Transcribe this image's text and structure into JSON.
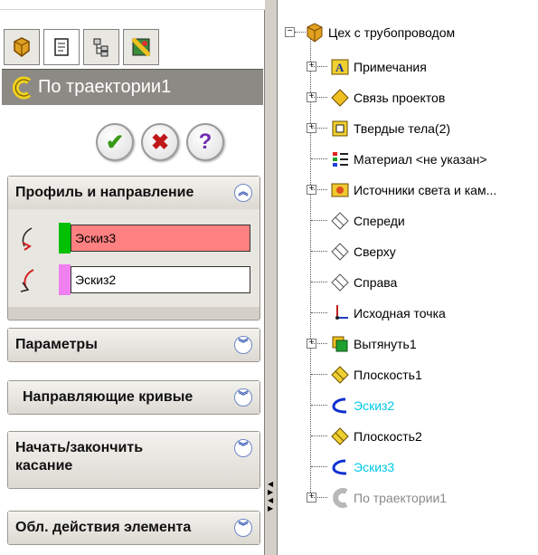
{
  "property_manager": {
    "feature_title": "По траектории1",
    "buttons": {
      "ok": "✔",
      "cancel": "✖",
      "help": "?"
    },
    "groups": {
      "profile": {
        "title": "Профиль и направление",
        "profile_sketch": "Эскиз3",
        "path_sketch": "Эскиз2",
        "profile_color": "#00c000",
        "profile_bg": "#ff8080",
        "path_color": "#f080f0"
      },
      "parameters": {
        "title": "Параметры"
      },
      "guide_curves": {
        "title": "Направляющие кривые"
      },
      "tangency": {
        "title": "Начать/закончить касание"
      },
      "scope": {
        "title": "Обл. действия элемента"
      }
    }
  },
  "feature_tree": {
    "root": "Цех с трубопроводом",
    "items": [
      {
        "label": "Примечания",
        "icon": "annotations-icon",
        "expandable": true
      },
      {
        "label": "Связь проектов",
        "icon": "design-binder-icon",
        "expandable": true
      },
      {
        "label": "Твердые тела(2)",
        "icon": "solid-bodies-icon",
        "expandable": true
      },
      {
        "label": "Материал <не указан>",
        "icon": "material-icon",
        "expandable": false
      },
      {
        "label": "Источники света и кам...",
        "icon": "lights-cameras-icon",
        "expandable": true
      },
      {
        "label": "Спереди",
        "icon": "plane-icon",
        "expandable": false
      },
      {
        "label": "Сверху",
        "icon": "plane-icon",
        "expandable": false
      },
      {
        "label": "Справа",
        "icon": "plane-icon",
        "expandable": false
      },
      {
        "label": "Исходная точка",
        "icon": "origin-icon",
        "expandable": false
      },
      {
        "label": "Вытянуть1",
        "icon": "extrude-icon",
        "expandable": true
      },
      {
        "label": "Плоскость1",
        "icon": "plane-yellow-icon",
        "expandable": false
      },
      {
        "label": "Эскиз2",
        "icon": "sketch-icon",
        "expandable": false,
        "highlight": "cyan"
      },
      {
        "label": "Плоскость2",
        "icon": "plane-yellow-icon",
        "expandable": false
      },
      {
        "label": "Эскиз3",
        "icon": "sketch-icon",
        "expandable": false,
        "highlight": "cyan"
      },
      {
        "label": "По траектории1",
        "icon": "sweep-icon",
        "expandable": true,
        "highlight": "grey"
      }
    ]
  }
}
